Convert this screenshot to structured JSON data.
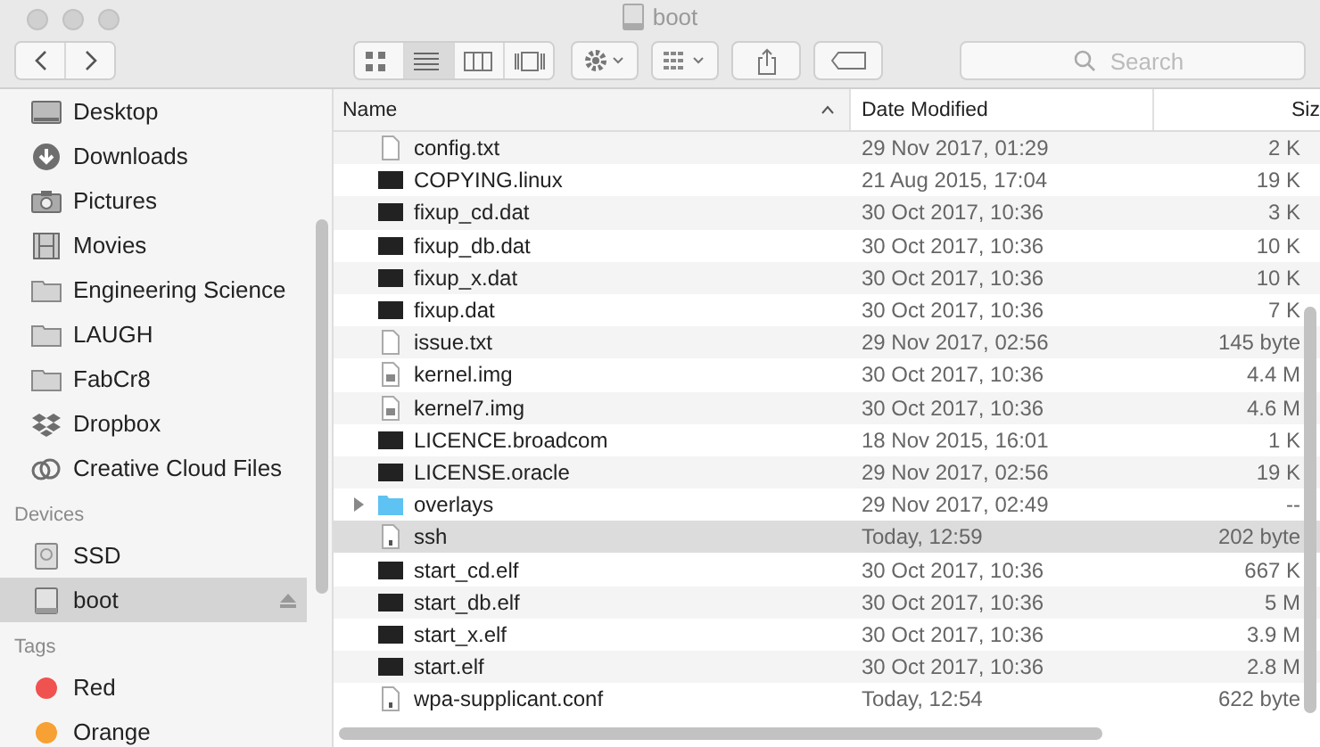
{
  "window": {
    "title": "boot"
  },
  "toolbar": {
    "views": [
      {
        "kind": "icons",
        "selected": false
      },
      {
        "kind": "list",
        "selected": true
      },
      {
        "kind": "columns",
        "selected": false
      },
      {
        "kind": "gallery",
        "selected": false
      }
    ],
    "search": {
      "placeholder": "Search"
    }
  },
  "sidebar": {
    "favorites": [
      {
        "label": "Desktop",
        "kind": "desktop",
        "selected": false
      },
      {
        "label": "Downloads",
        "kind": "download",
        "selected": false
      },
      {
        "label": "Pictures",
        "kind": "camera",
        "selected": false
      },
      {
        "label": "Movies",
        "kind": "film",
        "selected": false
      },
      {
        "label": "Engineering Science",
        "kind": "folder",
        "selected": false
      },
      {
        "label": "LAUGH",
        "kind": "folder",
        "selected": false
      },
      {
        "label": "FabCr8",
        "kind": "folder",
        "selected": false
      },
      {
        "label": "Dropbox",
        "kind": "dropbox",
        "selected": false
      },
      {
        "label": "Creative Cloud Files",
        "kind": "cloud",
        "selected": false
      }
    ],
    "devices_header": "Devices",
    "devices": [
      {
        "label": "SSD",
        "kind": "disk",
        "selected": false
      },
      {
        "label": "boot",
        "kind": "drive",
        "selected": true,
        "ejectable": true
      }
    ],
    "tags_header": "Tags",
    "tags": [
      {
        "label": "Red",
        "color": "#f0524f"
      },
      {
        "label": "Orange",
        "color": "#f7a033"
      }
    ]
  },
  "table": {
    "columns": [
      {
        "label": "Name",
        "sorted": true
      },
      {
        "label": "Date Modified"
      },
      {
        "label": "Siz"
      }
    ],
    "rows": [
      {
        "name": "config.txt",
        "kind": "document",
        "date": "29 Nov 2017, 01:29",
        "size": "2 K",
        "selected": false
      },
      {
        "name": "COPYING.linux",
        "kind": "exec",
        "date": "21 Aug 2015, 17:04",
        "size": "19 K",
        "selected": false
      },
      {
        "name": "fixup_cd.dat",
        "kind": "exec",
        "date": "30 Oct 2017, 10:36",
        "size": "3 K",
        "selected": false
      },
      {
        "name": "fixup_db.dat",
        "kind": "exec",
        "date": "30 Oct 2017, 10:36",
        "size": "10 K",
        "selected": false
      },
      {
        "name": "fixup_x.dat",
        "kind": "exec",
        "date": "30 Oct 2017, 10:36",
        "size": "10 K",
        "selected": false
      },
      {
        "name": "fixup.dat",
        "kind": "exec",
        "date": "30 Oct 2017, 10:36",
        "size": "7 K",
        "selected": false
      },
      {
        "name": "issue.txt",
        "kind": "document",
        "date": "29 Nov 2017, 02:56",
        "size": "145 byte",
        "selected": false
      },
      {
        "name": "kernel.img",
        "kind": "image",
        "date": "30 Oct 2017, 10:36",
        "size": "4.4 M",
        "selected": false
      },
      {
        "name": "kernel7.img",
        "kind": "image",
        "date": "30 Oct 2017, 10:36",
        "size": "4.6 M",
        "selected": false
      },
      {
        "name": "LICENCE.broadcom",
        "kind": "exec",
        "date": "18 Nov 2015, 16:01",
        "size": "1 K",
        "selected": false
      },
      {
        "name": "LICENSE.oracle",
        "kind": "exec",
        "date": "29 Nov 2017, 02:56",
        "size": "19 K",
        "selected": false
      },
      {
        "name": "overlays",
        "kind": "folder",
        "expanded": false,
        "date": "29 Nov 2017, 02:49",
        "size": "--",
        "selected": false
      },
      {
        "name": "ssh",
        "kind": "script",
        "date": "Today, 12:59",
        "size": "202 byte",
        "selected": true
      },
      {
        "name": "start_cd.elf",
        "kind": "exec",
        "date": "30 Oct 2017, 10:36",
        "size": "667 K",
        "selected": false
      },
      {
        "name": "start_db.elf",
        "kind": "exec",
        "date": "30 Oct 2017, 10:36",
        "size": "5 M",
        "selected": false
      },
      {
        "name": "start_x.elf",
        "kind": "exec",
        "date": "30 Oct 2017, 10:36",
        "size": "3.9 M",
        "selected": false
      },
      {
        "name": "start.elf",
        "kind": "exec",
        "date": "30 Oct 2017, 10:36",
        "size": "2.8 M",
        "selected": false
      },
      {
        "name": "wpa-supplicant.conf",
        "kind": "script",
        "date": "Today, 12:54",
        "size": "622 byte",
        "selected": false
      }
    ]
  }
}
